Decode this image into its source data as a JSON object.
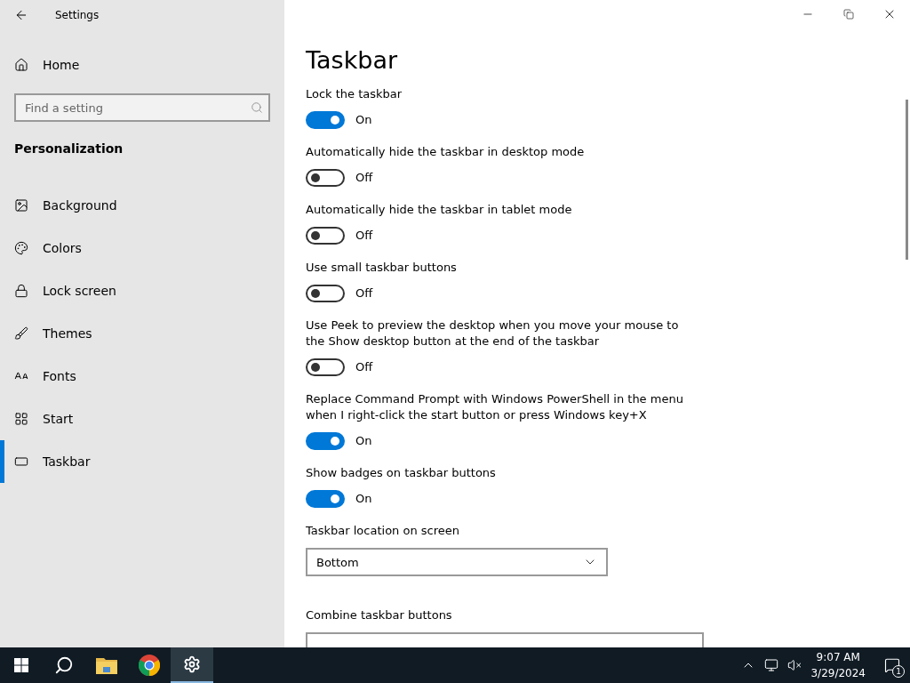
{
  "window": {
    "title": "Settings"
  },
  "sidebar": {
    "home": "Home",
    "search": {
      "placeholder": "Find a setting"
    },
    "section": "Personalization",
    "items": [
      {
        "label": "Background",
        "selected": false
      },
      {
        "label": "Colors",
        "selected": false
      },
      {
        "label": "Lock screen",
        "selected": false
      },
      {
        "label": "Themes",
        "selected": false
      },
      {
        "label": "Fonts",
        "selected": false
      },
      {
        "label": "Start",
        "selected": false
      },
      {
        "label": "Taskbar",
        "selected": true
      }
    ]
  },
  "page": {
    "title": "Taskbar",
    "settings": [
      {
        "kind": "toggle",
        "label": "Lock the taskbar",
        "on": true,
        "state": "On"
      },
      {
        "kind": "toggle",
        "label": "Automatically hide the taskbar in desktop mode",
        "on": false,
        "state": "Off"
      },
      {
        "kind": "toggle",
        "label": "Automatically hide the taskbar in tablet mode",
        "on": false,
        "state": "Off"
      },
      {
        "kind": "toggle",
        "label": "Use small taskbar buttons",
        "on": false,
        "state": "Off"
      },
      {
        "kind": "toggle",
        "label": "Use Peek to preview the desktop when you move your mouse to the Show desktop button at the end of the taskbar",
        "on": false,
        "state": "Off"
      },
      {
        "kind": "toggle",
        "label": "Replace Command Prompt with Windows PowerShell in the menu when I right-click the start button or press Windows key+X",
        "on": true,
        "state": "On"
      },
      {
        "kind": "toggle",
        "label": "Show badges on taskbar buttons",
        "on": true,
        "state": "On"
      },
      {
        "kind": "dropdown",
        "label": "Taskbar location on screen",
        "value": "Bottom",
        "wide": false
      },
      {
        "kind": "dropdown",
        "label": "Combine taskbar buttons",
        "wide": true
      }
    ]
  },
  "taskbar": {
    "time": "9:07 AM",
    "date": "3/29/2024",
    "notifications": "1"
  }
}
